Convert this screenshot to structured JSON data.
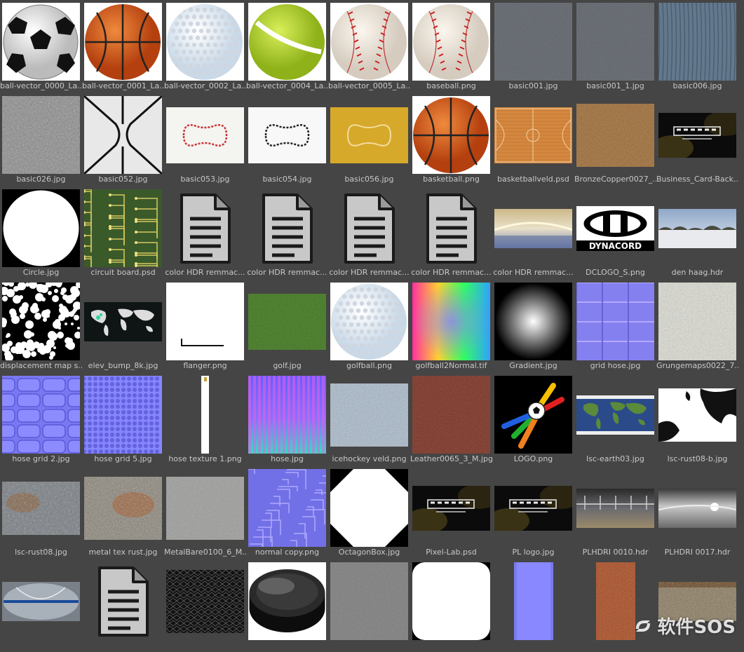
{
  "app": {
    "background": "#454545",
    "label_color": "#c8c8c8"
  },
  "files": [
    {
      "name": "ball-vector_0000_La...",
      "thumb": "soccer-ball-icon"
    },
    {
      "name": "ball-vector_0001_La...",
      "thumb": "basketball-icon"
    },
    {
      "name": "ball-vector_0002_La...",
      "thumb": "golf-ball-icon"
    },
    {
      "name": "ball-vector_0004_La...",
      "thumb": "tennis-ball-icon"
    },
    {
      "name": "ball-vector_0005_La...",
      "thumb": "baseball-icon"
    },
    {
      "name": "baseball.png",
      "thumb": "baseball-icon"
    },
    {
      "name": "basic001.jpg",
      "thumb": "grey-concrete-texture"
    },
    {
      "name": "basic001_1.jpg",
      "thumb": "grey-concrete-texture"
    },
    {
      "name": "basic006.jpg",
      "thumb": "blue-wood-texture"
    },
    {
      "name": "basic026.jpg",
      "thumb": "grey-noise-texture"
    },
    {
      "name": "basic052.jpg",
      "thumb": "court-lines-texture"
    },
    {
      "name": "basic053.jpg",
      "thumb": "stitch-outline-red"
    },
    {
      "name": "basic054.jpg",
      "thumb": "stitch-outline-black"
    },
    {
      "name": "basic056.jpg",
      "thumb": "stitch-outline-yellow"
    },
    {
      "name": "basketball.png",
      "thumb": "basketball-icon"
    },
    {
      "name": "basketballveld.psd",
      "thumb": "basketball-court-texture"
    },
    {
      "name": "BronzeCopper0027_...",
      "thumb": "bronze-texture"
    },
    {
      "name": "Business_Card-Back...",
      "thumb": "business-card-dark"
    },
    {
      "name": "Circle.jpg",
      "thumb": "white-circle"
    },
    {
      "name": "circuit board.psd",
      "thumb": "circuit-board-texture"
    },
    {
      "name": "color HDR remmac...",
      "thumb": "document-icon"
    },
    {
      "name": "color HDR remmac...",
      "thumb": "document-icon"
    },
    {
      "name": "color HDR remmac...",
      "thumb": "document-icon"
    },
    {
      "name": "color HDR remmac...",
      "thumb": "document-icon"
    },
    {
      "name": "color HDR remmac...",
      "thumb": "hdr-panorama"
    },
    {
      "name": "DCLOGO_S.png",
      "thumb": "dynacord-logo"
    },
    {
      "name": "den haag.hdr",
      "thumb": "snow-landscape"
    },
    {
      "name": "displacement map s...",
      "thumb": "black-white-noise"
    },
    {
      "name": "elev_bump_8k.jpg",
      "thumb": "world-map-dark"
    },
    {
      "name": "flanger.png",
      "thumb": "flanger-white"
    },
    {
      "name": "golf.jpg",
      "thumb": "grass-texture"
    },
    {
      "name": "golfball.png",
      "thumb": "golf-ball-icon"
    },
    {
      "name": "golfball2Normal.tif",
      "thumb": "rainbow-normal"
    },
    {
      "name": "Gradient.jpg",
      "thumb": "radial-gradient"
    },
    {
      "name": "grid hose.jpg",
      "thumb": "normal-grid"
    },
    {
      "name": "Grungemaps0022_7...",
      "thumb": "grunge-light"
    },
    {
      "name": "hose grid 2.jpg",
      "thumb": "normal-tiles"
    },
    {
      "name": "hose grid 5.jpg",
      "thumb": "normal-dimples"
    },
    {
      "name": "hose texture 1.png",
      "thumb": "hose-strip"
    },
    {
      "name": "hose.jpg",
      "thumb": "hose-normal-stripes"
    },
    {
      "name": "icehockey veld.png",
      "thumb": "ice-texture"
    },
    {
      "name": "Leather0065_3_M.jpg",
      "thumb": "leather-red"
    },
    {
      "name": "LOGO.png",
      "thumb": "colorful-logo"
    },
    {
      "name": "lsc-earth03.jpg",
      "thumb": "world-map-color"
    },
    {
      "name": "lsc-rust08-b.jpg",
      "thumb": "black-white-splat"
    },
    {
      "name": "lsc-rust08.jpg",
      "thumb": "rust-grey"
    },
    {
      "name": "metal tex rust.jpg",
      "thumb": "metal-rust"
    },
    {
      "name": "MetalBare0100_6_M...",
      "thumb": "metal-bare"
    },
    {
      "name": "normal copy.png",
      "thumb": "normal-circuit"
    },
    {
      "name": "OctagonBox.jpg",
      "thumb": "white-octagon"
    },
    {
      "name": "Pixel-Lab.psd",
      "thumb": "business-card-dark"
    },
    {
      "name": "PL logo.jpg",
      "thumb": "business-card-dark"
    },
    {
      "name": "PLHDRI 0010.hdr",
      "thumb": "hdr-hall"
    },
    {
      "name": "PLHDRI 0017.hdr",
      "thumb": "hdr-hall-bright"
    },
    {
      "name": "",
      "thumb": "hdr-fisheye"
    },
    {
      "name": "",
      "thumb": "document-icon"
    },
    {
      "name": "",
      "thumb": "dark-mesh"
    },
    {
      "name": "",
      "thumb": "hockey-puck"
    },
    {
      "name": "",
      "thumb": "concrete-grey"
    },
    {
      "name": "",
      "thumb": "white-rounded-square"
    },
    {
      "name": "",
      "thumb": "normal-strip"
    },
    {
      "name": "",
      "thumb": "rust-strip"
    },
    {
      "name": "",
      "thumb": "rust-panel"
    }
  ],
  "watermark": {
    "text": "软件SOS"
  }
}
